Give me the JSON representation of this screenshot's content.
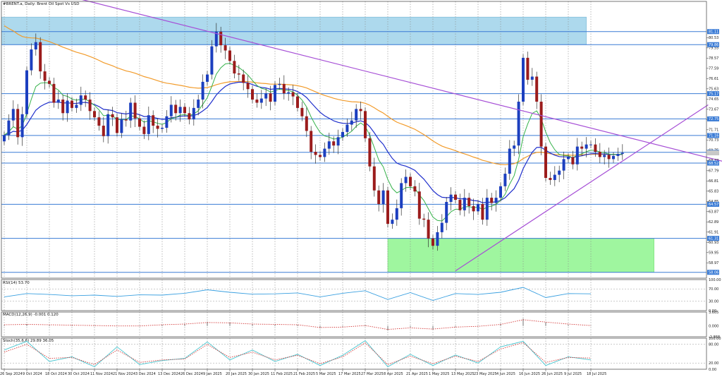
{
  "colors": {
    "background": "#ffffff",
    "bull_candle": "#1c3fbf",
    "bear_candle": "#9b1c1c",
    "grid": "#8c8c8c",
    "hline": "#3a7bd5",
    "trendline": "#a64fd6",
    "ema_fast": "#35b24a",
    "ema_mid": "#1f2fcc",
    "ema_slow": "#f29b2a",
    "resistance_zone": "#9fd3ea",
    "support_zone": "#8ff58f",
    "rsi_line": "#3aa0e0",
    "macd_signal": "#d43b3b",
    "stoch_main": "#48c6d0",
    "stoch_signal": "#d43b3b"
  },
  "chart_data": [
    {
      "type": "candlestick",
      "title": "#BRENT.a, Daily: Brent Oil Spot Vs USD",
      "ylim": [
        57.5,
        84.0
      ],
      "ytick_labels": [
        "80.53",
        "79.55",
        "78.57",
        "77.59",
        "76.61",
        "75.63",
        "74.65",
        "73.67",
        "72.69",
        "71.71",
        "70.73",
        "69.75",
        "68.77",
        "67.79",
        "66.81",
        "65.83",
        "64.85",
        "63.87",
        "62.89",
        "61.91",
        "60.93",
        "59.95",
        "58.97"
      ],
      "ytick_values": [
        80.53,
        79.55,
        78.57,
        77.59,
        76.61,
        75.63,
        74.65,
        73.67,
        72.69,
        71.71,
        70.73,
        69.75,
        68.77,
        67.79,
        66.81,
        65.83,
        64.85,
        63.87,
        62.89,
        61.91,
        60.93,
        59.95,
        58.97
      ],
      "horizontal_levels": [
        {
          "value": 81.11,
          "label": "81.11"
        },
        {
          "value": 79.86,
          "label": "79.86"
        },
        {
          "value": 75.17,
          "label": "75.17"
        },
        {
          "value": 72.75,
          "label": "72.75"
        },
        {
          "value": 71.16,
          "label": "71.16"
        },
        {
          "value": 69.55,
          "label": "69.55"
        },
        {
          "value": 68.52,
          "label": "68.52"
        },
        {
          "value": 64.57,
          "label": "64.57"
        },
        {
          "value": 61.31,
          "label": "61.31"
        },
        {
          "value": 58.06,
          "label": "58.06"
        }
      ],
      "zones": [
        {
          "name": "resistance",
          "from_index": 0,
          "to_index": 129,
          "low": 79.86,
          "high": 82.5
        },
        {
          "name": "support",
          "from_index": 85,
          "to_index": 144,
          "low": 58.06,
          "high": 61.31
        }
      ],
      "trendlines": [
        {
          "from": [
            17,
            84.2
          ],
          "to": [
            160,
            68.6
          ]
        },
        {
          "from": [
            100,
            58.2
          ],
          "to": [
            156,
            74.1
          ]
        }
      ],
      "x_labels": [
        "26 Sep 2024",
        "9 Oct 2024",
        "18 Oct 2024",
        "30 Oct 2024",
        "11 Nov 2024",
        "21 Nov 2024",
        "3 Dec 2024",
        "13 Dec 2024",
        "26 Dec 2024",
        "9 Jan 2025",
        "20 Jan 2025",
        "30 Jan 2025",
        "11 Feb 2025",
        "21 Feb 2025",
        "5 Mar 2025",
        "17 Mar 2025",
        "27 Mar 2025",
        "8 Apr 2025",
        "21 Apr 2025",
        "1 May 2025",
        "13 May 2025",
        "23 May 2025",
        "4 Jun 2025",
        "16 Jun 2025",
        "26 Jun 2025",
        "9 Jul 2025",
        "18 Jul 2025"
      ],
      "x_label_index": [
        0,
        5,
        10,
        15,
        20,
        25,
        30,
        35,
        40,
        45,
        50,
        55,
        60,
        65,
        70,
        75,
        80,
        85,
        90,
        95,
        100,
        105,
        110,
        115,
        120,
        125,
        130
      ],
      "closes": [
        71.2,
        72.6,
        73.7,
        71.0,
        73.2,
        77.4,
        79.4,
        80.1,
        77.3,
        76.4,
        76.1,
        74.3,
        74.6,
        73.3,
        74.5,
        73.8,
        74.1,
        75.0,
        74.6,
        73.5,
        72.9,
        72.1,
        71.1,
        73.2,
        72.9,
        71.4,
        72.7,
        72.6,
        74.3,
        72.8,
        72.0,
        71.3,
        73.1,
        72.1,
        71.8,
        71.9,
        73.0,
        74.1,
        73.3,
        73.9,
        73.3,
        72.7,
        73.8,
        74.6,
        76.3,
        77.0,
        79.7,
        81.1,
        79.8,
        79.3,
        78.3,
        77.1,
        77.0,
        76.2,
        75.6,
        74.6,
        74.3,
        74.7,
        75.2,
        74.4,
        76.0,
        76.1,
        75.2,
        75.3,
        74.9,
        73.8,
        73.0,
        71.6,
        69.6,
        69.3,
        69.1,
        69.9,
        70.6,
        70.2,
        71.0,
        71.5,
        72.2,
        72.6,
        73.7,
        73.5,
        70.9,
        68.2,
        65.9,
        64.6,
        65.9,
        62.7,
        63.1,
        64.2,
        66.6,
        67.2,
        66.3,
        65.8,
        63.2,
        63.1,
        61.3,
        60.6,
        61.9,
        62.8,
        64.8,
        65.5,
        65.0,
        64.0,
        65.2,
        64.4,
        63.9,
        64.6,
        63.1,
        65.2,
        64.7,
        65.2,
        66.3,
        67.5,
        69.9,
        70.2,
        74.4,
        78.6,
        76.5,
        76.8,
        74.4,
        70.1,
        67.1,
        66.9,
        67.4,
        67.8,
        68.9,
        69.1,
        68.4,
        70.1,
        69.9,
        70.3,
        70.3,
        69.6,
        69.1,
        69.3,
        68.9,
        69.2,
        69.4,
        69.5
      ]
    },
    {
      "type": "line",
      "title": "RSI(14) 53.70",
      "ylim": [
        0,
        100
      ],
      "ytick_labels": [
        "100.00",
        "70.00",
        "30.00",
        "0.00"
      ],
      "ytick_values": [
        100,
        70,
        30,
        0
      ],
      "guides": [
        70,
        30
      ],
      "value_at_x_label_index": [
        44,
        55,
        52,
        48,
        50,
        46,
        51,
        50,
        56,
        67,
        59,
        53,
        54,
        57,
        44,
        56,
        64,
        36,
        58,
        33,
        55,
        52,
        59,
        75,
        42,
        55,
        54
      ]
    },
    {
      "type": "histogram",
      "title": "MACD(12,26,9) -0.001 0.120",
      "ylim": [
        -2.8,
        3.6
      ],
      "ytick_labels": [
        "3.605",
        "0.000",
        "-2.868"
      ],
      "ytick_values": [
        3.605,
        0.0,
        -2.868
      ],
      "histogram_at_x_label_index": [
        0.2,
        0.5,
        0.3,
        0.2,
        0.1,
        0.0,
        -0.1,
        0.3,
        0.6,
        1.1,
        0.9,
        0.5,
        0.4,
        0.3,
        -0.6,
        -0.2,
        0.2,
        -1.2,
        -0.3,
        -1.0,
        -0.2,
        -0.1,
        0.6,
        1.9,
        0.9,
        0.3,
        0.1
      ],
      "signal_at_x_label_index": [
        0.3,
        0.4,
        0.3,
        0.2,
        0.1,
        0.0,
        0.0,
        0.3,
        0.5,
        0.9,
        0.8,
        0.5,
        0.4,
        0.3,
        -0.4,
        -0.3,
        0.1,
        -0.9,
        -0.5,
        -0.8,
        -0.3,
        -0.1,
        0.4,
        1.6,
        1.0,
        0.5,
        0.1
      ]
    },
    {
      "type": "line",
      "title": "Stoch(35,6,6) 29.89 36.05",
      "ylim": [
        0,
        100
      ],
      "ytick_labels": [
        "100.00",
        "80.00",
        "20.00",
        "0.00"
      ],
      "ytick_values": [
        100,
        80,
        20,
        0
      ],
      "guides": [
        80,
        20
      ],
      "main_at_x_label_index": [
        62,
        90,
        25,
        40,
        8,
        72,
        15,
        28,
        35,
        88,
        30,
        62,
        25,
        48,
        12,
        45,
        92,
        8,
        48,
        12,
        46,
        20,
        72,
        90,
        12,
        40,
        30
      ],
      "signal_at_x_label_index": [
        55,
        80,
        35,
        38,
        15,
        62,
        22,
        30,
        33,
        80,
        38,
        55,
        30,
        45,
        18,
        40,
        85,
        15,
        42,
        18,
        42,
        25,
        65,
        86,
        22,
        38,
        36
      ]
    }
  ]
}
